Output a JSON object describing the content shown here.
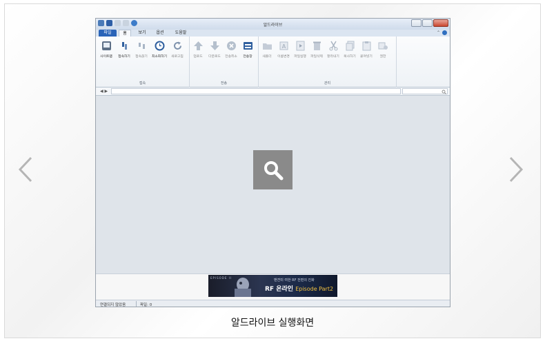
{
  "window": {
    "title": "알드라이브",
    "tabs": [
      "파일",
      "홈",
      "보기",
      "옵션",
      "도움말"
    ]
  },
  "ribbon": {
    "groups": [
      {
        "label": "접속",
        "buttons": [
          {
            "label": "사이트맵",
            "icon": "sitemap-icon"
          },
          {
            "label": "접속하기",
            "icon": "connect-icon"
          },
          {
            "label": "접속끊기",
            "icon": "disconnect-icon"
          },
          {
            "label": "최소화하기",
            "icon": "minimize-clock-icon"
          },
          {
            "label": "새로고침",
            "icon": "refresh-icon"
          }
        ]
      },
      {
        "label": "전송",
        "buttons": [
          {
            "label": "업로드",
            "icon": "upload-icon"
          },
          {
            "label": "다운로드",
            "icon": "download-icon"
          },
          {
            "label": "전송취소",
            "icon": "cancel-transfer-icon"
          },
          {
            "label": "전송창",
            "icon": "transfer-window-icon"
          }
        ]
      },
      {
        "label": "관리",
        "buttons": [
          {
            "label": "새폴더",
            "icon": "new-folder-icon"
          },
          {
            "label": "이름변경",
            "icon": "rename-icon"
          },
          {
            "label": "파일실행",
            "icon": "run-file-icon"
          },
          {
            "label": "파일삭제",
            "icon": "delete-file-icon"
          },
          {
            "label": "잘라내기",
            "icon": "cut-icon"
          },
          {
            "label": "복사하기",
            "icon": "copy-icon"
          },
          {
            "label": "붙여넣기",
            "icon": "paste-icon"
          },
          {
            "label": "권한",
            "icon": "permission-icon"
          }
        ]
      }
    ]
  },
  "address": {
    "back": "◀",
    "forward": "▶",
    "value": "",
    "search_placeholder": ""
  },
  "banner": {
    "brand": "EPISODE II",
    "tagline": "밴젼미 여한 RF 전편의 진화",
    "game": "RF 온라인",
    "episode": "Episode Part2"
  },
  "status": {
    "connection": "연결되지 않았음",
    "files": "파일: 0"
  },
  "caption": "알드라이브 실행화면",
  "colors": {
    "file_tab": "#2a64b8",
    "zoom_overlay": "#8a8a8a",
    "content_bg": "#dfe4ea"
  }
}
